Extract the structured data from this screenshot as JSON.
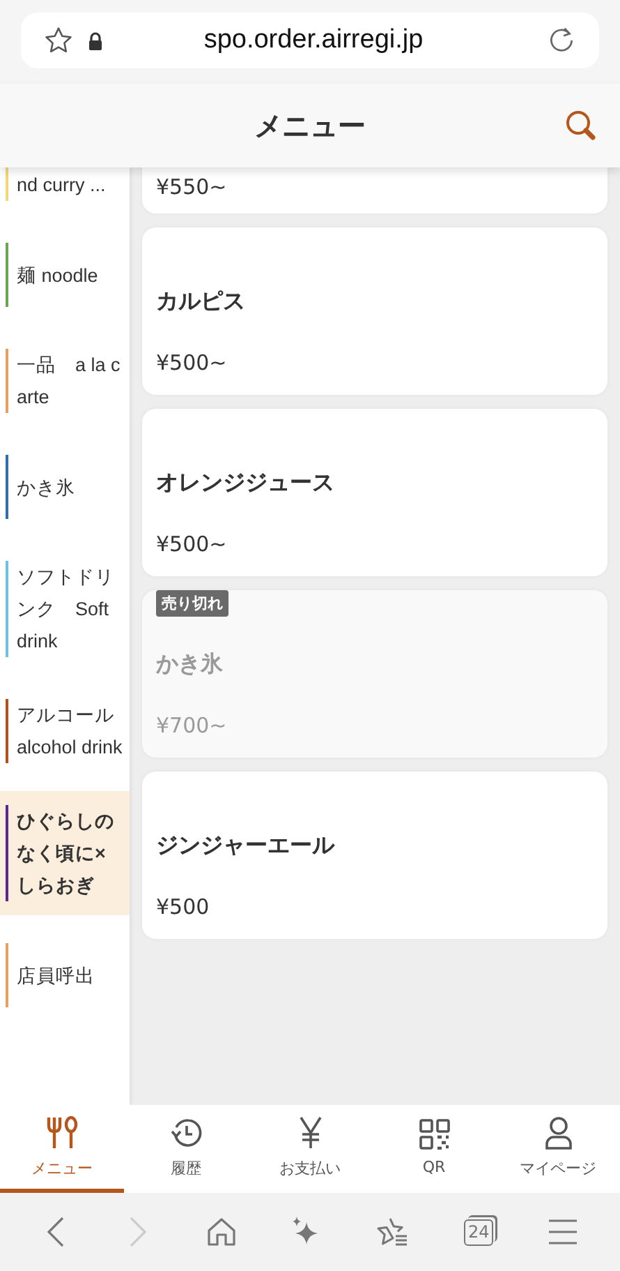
{
  "browser": {
    "url": "spo.order.airregi.jp",
    "tab_count": "24",
    "can_go_forward": false
  },
  "header": {
    "title": "メニュー"
  },
  "categories": [
    {
      "label": "nd curry ...",
      "color": "#f0d878",
      "selected": false
    },
    {
      "label": "麺 noodle",
      "color": "#6aa84f",
      "selected": false
    },
    {
      "label": "一品　a la carte",
      "color": "#e8a060",
      "selected": false
    },
    {
      "label": "かき氷",
      "color": "#2f6ea8",
      "selected": false
    },
    {
      "label": "ソフトドリンク　Soft drink",
      "color": "#6cc3dd",
      "selected": false
    },
    {
      "label": "アルコール alcohol drink",
      "color": "#b0521e",
      "selected": false
    },
    {
      "label": "ひぐらしのなく頃に×しらおぎ",
      "color": "#5b2a86",
      "selected": true
    },
    {
      "label": "店員呼出",
      "color": "#e8a060",
      "selected": false
    }
  ],
  "items": [
    {
      "price": "¥550~",
      "sold_out": false
    },
    {
      "name": "カルピス",
      "price": "¥500~",
      "sold_out": false
    },
    {
      "name": "オレンジジュース",
      "price": "¥500~",
      "sold_out": false
    },
    {
      "name": "かき氷",
      "price": "¥700~",
      "sold_out": true,
      "badge": "売り切れ"
    },
    {
      "name": "ジンジャーエール",
      "price": "¥500",
      "sold_out": false
    }
  ],
  "tabs": [
    {
      "label": "メニュー",
      "kind": "menu",
      "selected": true
    },
    {
      "label": "履歴",
      "kind": "history",
      "selected": false
    },
    {
      "label": "お支払い",
      "kind": "payment",
      "selected": false
    },
    {
      "label": "QR",
      "kind": "qr",
      "selected": false
    },
    {
      "label": "マイページ",
      "kind": "mypage",
      "selected": false
    }
  ]
}
